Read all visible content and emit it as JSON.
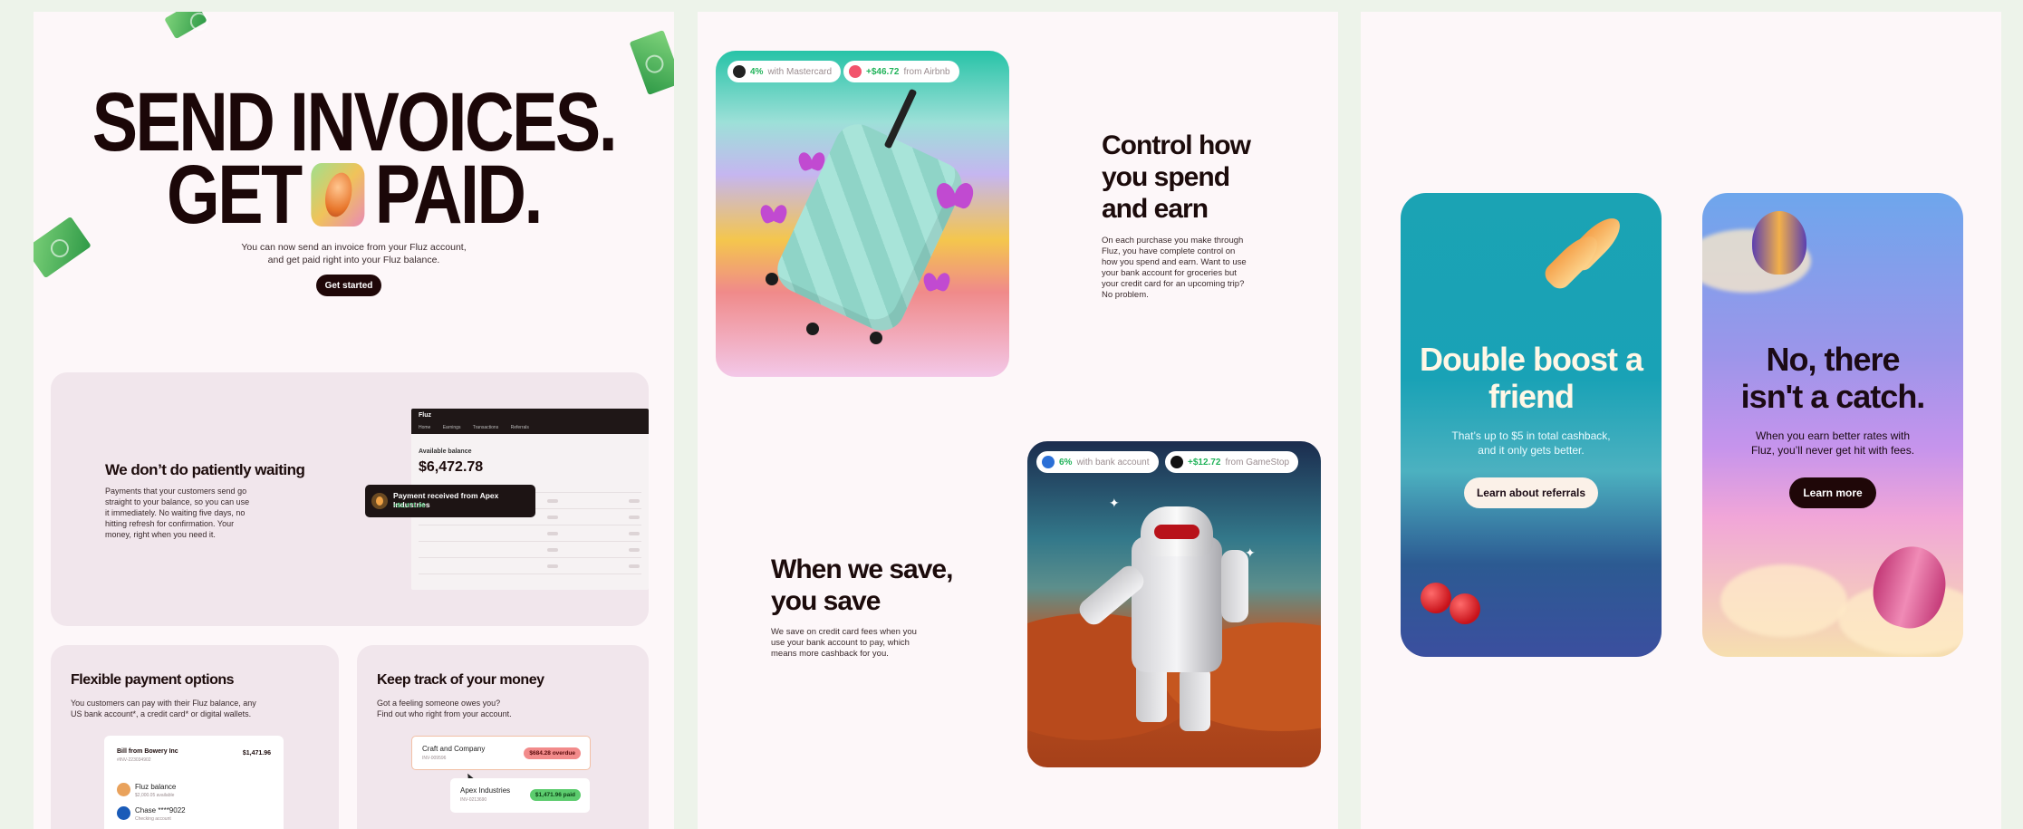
{
  "panel1": {
    "hero": {
      "line1": "SEND INVOICES.",
      "line2_left": "GET",
      "line2_right": "PAID.",
      "subtitle": "You can now send an invoice from your Fluz account,\nand get paid right into your Fluz balance.",
      "cta_label": "Get started"
    },
    "waiting_card": {
      "title": "We don’t do patiently waiting",
      "body": "Payments that your customers send go\nstraight to your balance, so you can use\nit immediately. No waiting five days, no\nhitting refresh for confirmation. Your\nmoney, right when you need it.",
      "dashboard": {
        "logo": "Fluz",
        "nav": "Home Earnings Transactions Referrals",
        "balance_label": "Available balance",
        "balance_value": "$6,472.78"
      },
      "toast": {
        "title": "Payment received from Apex Industries",
        "amount": "+$1,471.96"
      }
    },
    "flex_card": {
      "title": "Flexible payment options",
      "body": "You customers can pay with their Fluz balance, any\nUS bank account*, a credit card* or digital wallets.",
      "bill": {
        "title": "Bill from Bowery Inc",
        "invoice": "#INV-223034902",
        "amount": "$1,471.96"
      },
      "options": [
        {
          "name": "Fluz balance",
          "sub": "$2,000.05 available",
          "color": "#e9a25c"
        },
        {
          "name": "Chase ****9022",
          "sub": "Checking account",
          "color": "#1a5bb8"
        }
      ]
    },
    "track_card": {
      "title": "Keep track of your money",
      "body": "Got a feeling someone owes you?\nFind out who right from your account.",
      "invoices": [
        {
          "name": "Craft and Company",
          "sub": "INV-009596",
          "badge": "$684.28 overdue",
          "badge_color": "#f28b8b"
        },
        {
          "name": "Apex Industries",
          "sub": "INV-0213690",
          "badge": "$1,471.96 paid",
          "badge_color": "#5ccc6e"
        }
      ]
    }
  },
  "panel2": {
    "suitcase_card": {
      "pills": [
        {
          "value": "4%",
          "text": "with Mastercard",
          "icon_color": "#222222"
        },
        {
          "value": "+$46.72",
          "text": "from Airbnb",
          "icon_color": "#f2536c"
        }
      ]
    },
    "control": {
      "title": "Control how\nyou spend\nand earn",
      "body": "On each purchase you make through\nFluz, you have complete control on\nhow you spend and earn. Want to use\nyour bank account for groceries but\nyour credit card for an upcoming trip?\nNo problem."
    },
    "robot_card": {
      "pills": [
        {
          "value": "6%",
          "text": "with bank account",
          "icon_color": "#2b6fd6"
        },
        {
          "value": "+$12.72",
          "text": "from GameStop",
          "icon_color": "#111111"
        }
      ]
    },
    "save": {
      "title": "When we save,\nyou save",
      "body": "We save on credit card fees when you\nuse your bank account to pay, which\nmeans more cashback for you."
    }
  },
  "panel3": {
    "referral": {
      "title": "Double boost a\nfriend",
      "body": "That’s up to $5 in total cashback,\nand it only gets better.",
      "cta_label": "Learn about referrals"
    },
    "catch": {
      "title": "No, there\nisn't a catch.",
      "body": "When you earn better rates with\nFluz, you’ll never get hit with fees.",
      "cta_label": "Learn more"
    }
  },
  "colors": {
    "page_bg": "#edf3ea",
    "panel_bg": "#fdf7f9",
    "ink": "#1c0b0b",
    "positive": "#21b35a",
    "card_lilac": "#f1e6ec"
  }
}
